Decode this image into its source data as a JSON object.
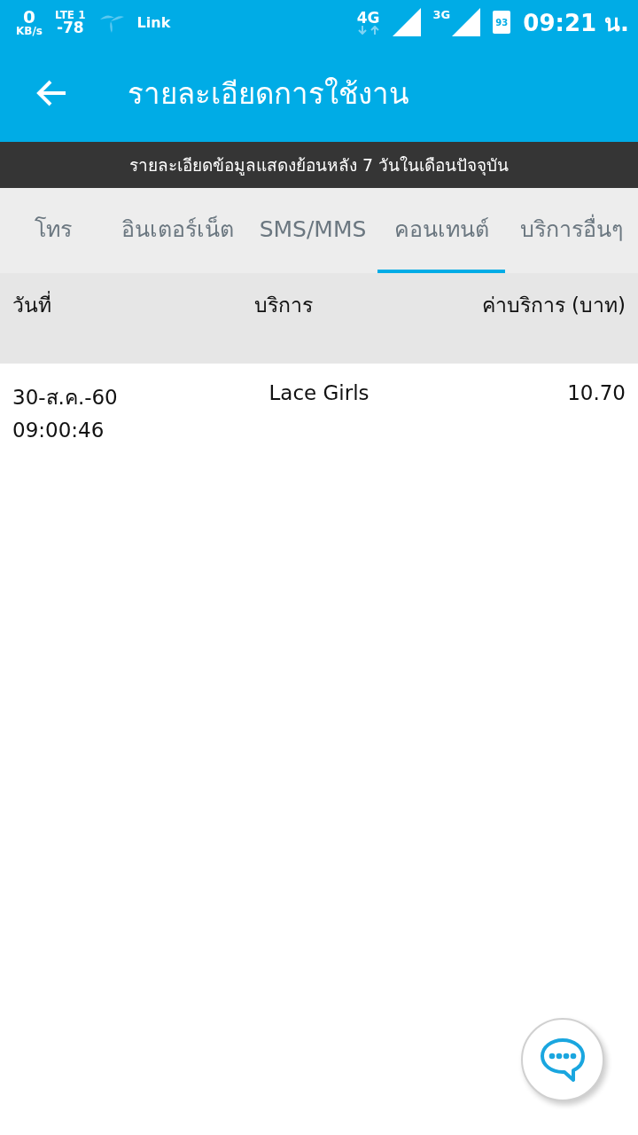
{
  "status_bar": {
    "speed": "0",
    "speed_unit": "KB/s",
    "network": "LTE 1",
    "signal_dbm": "-78",
    "carrier": "Link",
    "data_type": "4G",
    "second_network": "3G",
    "battery": "93",
    "time": "09:21 น."
  },
  "app_bar": {
    "title": "รายละเอียดการใช้งาน"
  },
  "notice": "รายละเอียดข้อมูลแสดงย้อนหลัง 7 วันในเดือนปัจจุบัน",
  "tabs": [
    {
      "label": "โทร",
      "selected": false
    },
    {
      "label": "อินเตอร์เน็ต",
      "selected": false
    },
    {
      "label": "SMS/MMS",
      "selected": false
    },
    {
      "label": "คอนเทนต์",
      "selected": true
    },
    {
      "label": "บริการอื่นๆ",
      "selected": false
    }
  ],
  "table": {
    "columns": [
      "วันที่",
      "บริการ",
      "ค่าบริการ (บาท)"
    ],
    "rows": [
      {
        "date": "30-ส.ค.-60",
        "time": "09:00:46",
        "service": "Lace Girls",
        "charge": "10.70"
      }
    ]
  }
}
